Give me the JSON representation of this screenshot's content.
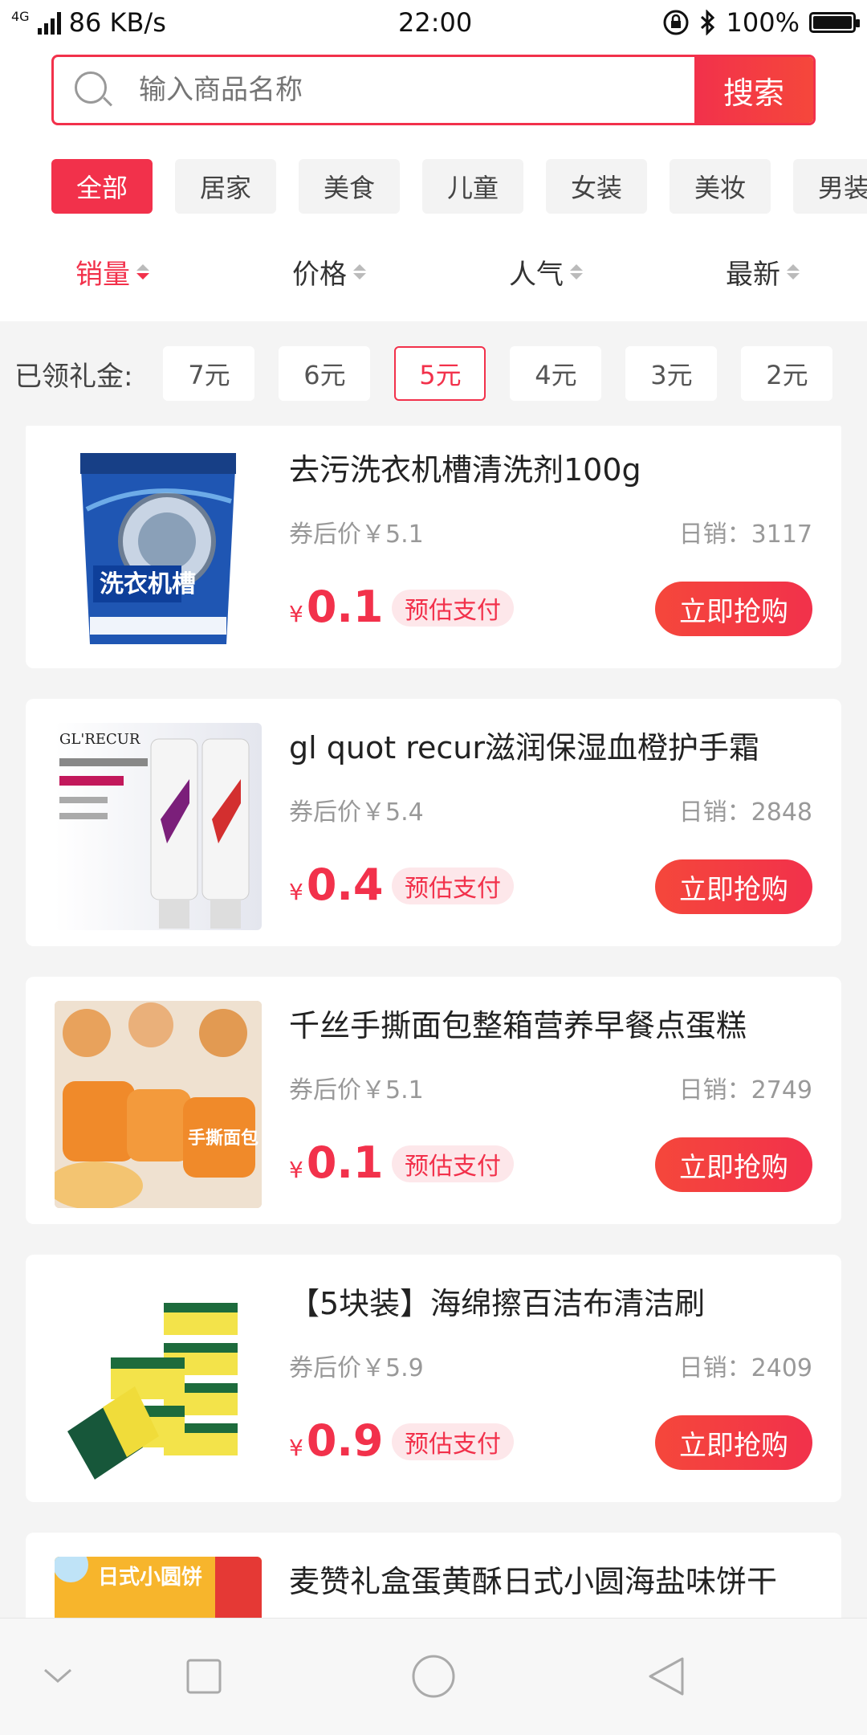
{
  "status_bar": {
    "network": "4G",
    "speed": "86 KB/s",
    "time": "22:00",
    "battery": "100%"
  },
  "search": {
    "placeholder": "输入商品名称",
    "button_label": "搜索"
  },
  "categories": [
    "全部",
    "居家",
    "美食",
    "儿童",
    "女装",
    "美妆",
    "男装"
  ],
  "active_category": "全部",
  "sort_options": [
    "销量",
    "价格",
    "人气",
    "最新"
  ],
  "active_sort": "销量",
  "gift_filter": {
    "label": "已领礼金:",
    "options": [
      "7元",
      "6元",
      "5元",
      "4元",
      "3元",
      "2元"
    ],
    "selected": "5元"
  },
  "products": [
    {
      "title": "去污洗衣机槽清洗剂100g",
      "after_coupon": "券后价￥5.1",
      "daily_sales": "日销：3117",
      "currency": "¥",
      "price": "0.1",
      "badge": "预估支付",
      "buy_label": "立即抢购",
      "image_text": "洗衣机槽"
    },
    {
      "title": "gl quot recur滋润保湿血橙护手霜",
      "after_coupon": "券后价￥5.4",
      "daily_sales": "日销：2848",
      "currency": "¥",
      "price": "0.4",
      "badge": "预估支付",
      "buy_label": "立即抢购",
      "image_text": "GL'RECUR"
    },
    {
      "title": "千丝手撕面包整箱营养早餐点蛋糕",
      "after_coupon": "券后价￥5.1",
      "daily_sales": "日销：2749",
      "currency": "¥",
      "price": "0.1",
      "badge": "预估支付",
      "buy_label": "立即抢购",
      "image_text": "手撕面包"
    },
    {
      "title": "【5块装】海绵擦百洁布清洁刷",
      "after_coupon": "券后价￥5.9",
      "daily_sales": "日销：2409",
      "currency": "¥",
      "price": "0.9",
      "badge": "预估支付",
      "buy_label": "立即抢购",
      "image_text": ""
    },
    {
      "title": "麦赞礼盒蛋黄酥日式小圆海盐味饼干",
      "after_coupon": "",
      "daily_sales": "",
      "currency": "",
      "price": "",
      "badge": "",
      "buy_label": "",
      "image_text": "日式小圆饼"
    }
  ],
  "colors": {
    "accent": "#f2314b",
    "badge_bg": "#fde7ea",
    "page_bg": "#f4f4f4"
  },
  "nav_icons": [
    "chevron-down-icon",
    "square-icon",
    "circle-icon",
    "back-triangle-icon"
  ]
}
